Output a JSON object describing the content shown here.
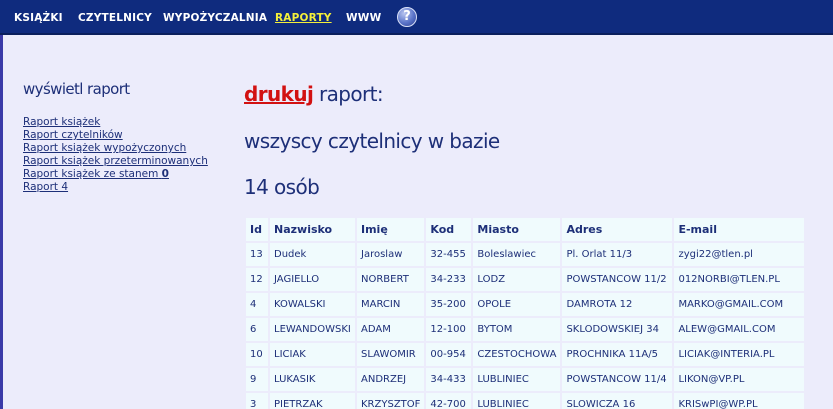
{
  "nav": {
    "items": [
      {
        "label": "KSIĄŻKI"
      },
      {
        "label": "CZYTELNICY"
      },
      {
        "label": "WYPOŻYCZALNIA"
      },
      {
        "label": "RAPORTY"
      },
      {
        "label": "WWW"
      }
    ],
    "help_label": "?"
  },
  "sidebar": {
    "title": "wyświetl raport",
    "links": [
      {
        "label": "Raport książek"
      },
      {
        "label": "Raport czytelników"
      },
      {
        "label": "Raport książek wypożyczonych"
      },
      {
        "label": "Raport książek przeterminowanych"
      },
      {
        "label": "Raport książek ze stanem",
        "bold_suffix": "0"
      },
      {
        "label": "Raport 4"
      }
    ]
  },
  "main": {
    "print_link": "drukuj",
    "heading_suffix": " raport:",
    "subtitle": "wszyscy czytelnicy w bazie",
    "count": "14 osób"
  },
  "table": {
    "columns": [
      "Id",
      "Nazwisko",
      "Imię",
      "Kod",
      "Miasto",
      "Adres",
      "E-mail"
    ],
    "rows": [
      [
        "13",
        "Dudek",
        "Jaroslaw",
        "32-455",
        "Boleslawiec",
        "Pl. Orlat 11/3",
        "zygi22@tlen.pl"
      ],
      [
        "12",
        "JAGIELLO",
        "NORBERT",
        "34-233",
        "LODZ",
        "POWSTANCOW 11/2",
        "012NORBI@TLEN.PL"
      ],
      [
        "4",
        "KOWALSKI",
        "MARCIN",
        "35-200",
        "OPOLE",
        "DAMROTA 12",
        "MARKO@GMAIL.COM"
      ],
      [
        "6",
        "LEWANDOWSKI",
        "ADAM",
        "12-100",
        "BYTOM",
        "SKLODOWSKIEJ 34",
        "ALEW@GMAIL.COM"
      ],
      [
        "10",
        "LICIAK",
        "SLAWOMIR",
        "00-954",
        "CZESTOCHOWA",
        "PROCHNIKA 11A/5",
        "LICIAK@INTERIA.PL"
      ],
      [
        "9",
        "LUKASIK",
        "ANDRZEJ",
        "34-433",
        "LUBLINIEC",
        "POWSTANCOW 11/4",
        "LIKON@VP.PL"
      ],
      [
        "3",
        "PIETRZAK",
        "KRZYSZTOF",
        "42-700",
        "LUBLINIEC",
        "SLOWICZA 16",
        "KRISwPI@WP.PL"
      ]
    ]
  },
  "colors": {
    "nav_bg": "#0f2b7e",
    "nav_active": "#f3ef3a",
    "page_bg": "#ececfb",
    "text": "#1d2f78",
    "print_link": "#d21111",
    "cell_bg": "#f0fbfd"
  }
}
